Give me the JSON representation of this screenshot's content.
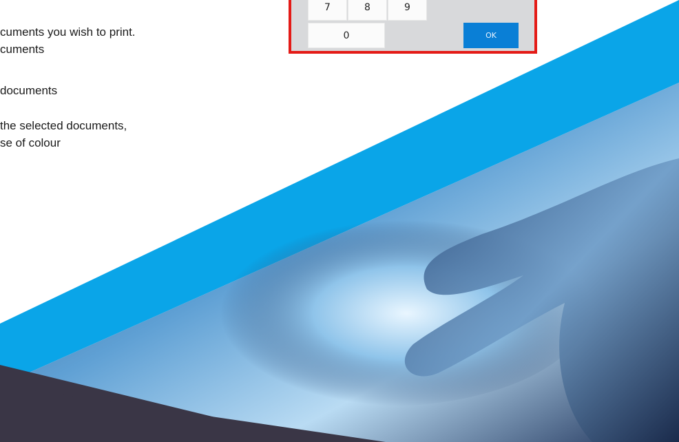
{
  "instructions": {
    "line1": "cuments you wish to print.",
    "line2": "cuments",
    "line3": "documents",
    "line4": "the selected documents,",
    "line5": "se of colour"
  },
  "keypad": {
    "keys": {
      "k7": "7",
      "k8": "8",
      "k9": "9",
      "k0": "0"
    },
    "ok_label": "OK"
  },
  "colors": {
    "accent_blue": "#0a7fd6",
    "highlight_red": "#e41b17",
    "banner_blue": "#0aa5e8",
    "dark_band": "#3a3646"
  }
}
